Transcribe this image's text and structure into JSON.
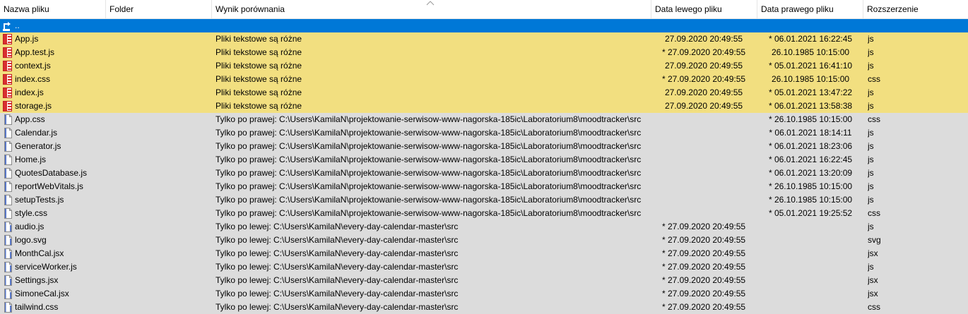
{
  "columns": {
    "name": "Nazwa pliku",
    "folder": "Folder",
    "result": "Wynik porównania",
    "left_date": "Data lewego pliku",
    "right_date": "Data prawego pliku",
    "extension": "Rozszerzenie"
  },
  "updir": {
    "label": "..",
    "icon": "up-folder-icon"
  },
  "rows": [
    {
      "name": "App.js",
      "folder": "",
      "result": "Pliki tekstowe są różne",
      "left_date": "27.09.2020 20:49:55",
      "right_date": "* 06.01.2021 16:22:45",
      "ext": "js",
      "status": "diff",
      "icon": "diff-file-icon"
    },
    {
      "name": "App.test.js",
      "folder": "",
      "result": "Pliki tekstowe są różne",
      "left_date": "* 27.09.2020 20:49:55",
      "right_date": "26.10.1985 10:15:00",
      "ext": "js",
      "status": "diff",
      "icon": "diff-file-icon"
    },
    {
      "name": "context.js",
      "folder": "",
      "result": "Pliki tekstowe są różne",
      "left_date": "27.09.2020 20:49:55",
      "right_date": "* 05.01.2021 16:41:10",
      "ext": "js",
      "status": "diff",
      "icon": "diff-file-icon"
    },
    {
      "name": "index.css",
      "folder": "",
      "result": "Pliki tekstowe są różne",
      "left_date": "* 27.09.2020 20:49:55",
      "right_date": "26.10.1985 10:15:00",
      "ext": "css",
      "status": "diff",
      "icon": "diff-file-icon"
    },
    {
      "name": "index.js",
      "folder": "",
      "result": "Pliki tekstowe są różne",
      "left_date": "27.09.2020 20:49:55",
      "right_date": "* 05.01.2021 13:47:22",
      "ext": "js",
      "status": "diff",
      "icon": "diff-file-icon"
    },
    {
      "name": "storage.js",
      "folder": "",
      "result": "Pliki tekstowe są różne",
      "left_date": "27.09.2020 20:49:55",
      "right_date": "* 06.01.2021 13:58:38",
      "ext": "js",
      "status": "diff",
      "icon": "diff-file-icon"
    },
    {
      "name": "App.css",
      "folder": "",
      "result": "Tylko po prawej: C:\\Users\\KamilaN\\projektowanie-serwisow-www-nagorska-185ic\\Laboratorium8\\moodtracker\\src",
      "left_date": "",
      "right_date": "* 26.10.1985 10:15:00",
      "ext": "css",
      "status": "only",
      "icon": "right-file-icon"
    },
    {
      "name": "Calendar.js",
      "folder": "",
      "result": "Tylko po prawej: C:\\Users\\KamilaN\\projektowanie-serwisow-www-nagorska-185ic\\Laboratorium8\\moodtracker\\src",
      "left_date": "",
      "right_date": "* 06.01.2021 18:14:11",
      "ext": "js",
      "status": "only",
      "icon": "right-file-icon"
    },
    {
      "name": "Generator.js",
      "folder": "",
      "result": "Tylko po prawej: C:\\Users\\KamilaN\\projektowanie-serwisow-www-nagorska-185ic\\Laboratorium8\\moodtracker\\src",
      "left_date": "",
      "right_date": "* 06.01.2021 18:23:06",
      "ext": "js",
      "status": "only",
      "icon": "right-file-icon"
    },
    {
      "name": "Home.js",
      "folder": "",
      "result": "Tylko po prawej: C:\\Users\\KamilaN\\projektowanie-serwisow-www-nagorska-185ic\\Laboratorium8\\moodtracker\\src",
      "left_date": "",
      "right_date": "* 06.01.2021 16:22:45",
      "ext": "js",
      "status": "only",
      "icon": "right-file-icon"
    },
    {
      "name": "QuotesDatabase.js",
      "folder": "",
      "result": "Tylko po prawej: C:\\Users\\KamilaN\\projektowanie-serwisow-www-nagorska-185ic\\Laboratorium8\\moodtracker\\src",
      "left_date": "",
      "right_date": "* 06.01.2021 13:20:09",
      "ext": "js",
      "status": "only",
      "icon": "right-file-icon"
    },
    {
      "name": "reportWebVitals.js",
      "folder": "",
      "result": "Tylko po prawej: C:\\Users\\KamilaN\\projektowanie-serwisow-www-nagorska-185ic\\Laboratorium8\\moodtracker\\src",
      "left_date": "",
      "right_date": "* 26.10.1985 10:15:00",
      "ext": "js",
      "status": "only",
      "icon": "right-file-icon"
    },
    {
      "name": "setupTests.js",
      "folder": "",
      "result": "Tylko po prawej: C:\\Users\\KamilaN\\projektowanie-serwisow-www-nagorska-185ic\\Laboratorium8\\moodtracker\\src",
      "left_date": "",
      "right_date": "* 26.10.1985 10:15:00",
      "ext": "js",
      "status": "only",
      "icon": "right-file-icon"
    },
    {
      "name": "style.css",
      "folder": "",
      "result": "Tylko po prawej: C:\\Users\\KamilaN\\projektowanie-serwisow-www-nagorska-185ic\\Laboratorium8\\moodtracker\\src",
      "left_date": "",
      "right_date": "* 05.01.2021 19:25:52",
      "ext": "css",
      "status": "only",
      "icon": "right-file-icon"
    },
    {
      "name": "audio.js",
      "folder": "",
      "result": "Tylko po lewej: C:\\Users\\KamilaN\\every-day-calendar-master\\src",
      "left_date": "* 27.09.2020 20:49:55",
      "right_date": "",
      "ext": "js",
      "status": "only",
      "icon": "left-file-icon"
    },
    {
      "name": "logo.svg",
      "folder": "",
      "result": "Tylko po lewej: C:\\Users\\KamilaN\\every-day-calendar-master\\src",
      "left_date": "* 27.09.2020 20:49:55",
      "right_date": "",
      "ext": "svg",
      "status": "only",
      "icon": "left-file-icon"
    },
    {
      "name": "MonthCal.jsx",
      "folder": "",
      "result": "Tylko po lewej: C:\\Users\\KamilaN\\every-day-calendar-master\\src",
      "left_date": "* 27.09.2020 20:49:55",
      "right_date": "",
      "ext": "jsx",
      "status": "only",
      "icon": "left-file-icon"
    },
    {
      "name": "serviceWorker.js",
      "folder": "",
      "result": "Tylko po lewej: C:\\Users\\KamilaN\\every-day-calendar-master\\src",
      "left_date": "* 27.09.2020 20:49:55",
      "right_date": "",
      "ext": "js",
      "status": "only",
      "icon": "left-file-icon"
    },
    {
      "name": "Settings.jsx",
      "folder": "",
      "result": "Tylko po lewej: C:\\Users\\KamilaN\\every-day-calendar-master\\src",
      "left_date": "* 27.09.2020 20:49:55",
      "right_date": "",
      "ext": "jsx",
      "status": "only",
      "icon": "left-file-icon"
    },
    {
      "name": "SimoneCal.jsx",
      "folder": "",
      "result": "Tylko po lewej: C:\\Users\\KamilaN\\every-day-calendar-master\\src",
      "left_date": "* 27.09.2020 20:49:55",
      "right_date": "",
      "ext": "jsx",
      "status": "only",
      "icon": "left-file-icon"
    },
    {
      "name": "tailwind.css",
      "folder": "",
      "result": "Tylko po lewej: C:\\Users\\KamilaN\\every-day-calendar-master\\src",
      "left_date": "* 27.09.2020 20:49:55",
      "right_date": "",
      "ext": "css",
      "status": "only",
      "icon": "left-file-icon"
    }
  ],
  "colors": {
    "selected": "#0078d7",
    "different": "#f2df80",
    "unique": "#dcdcdc"
  }
}
